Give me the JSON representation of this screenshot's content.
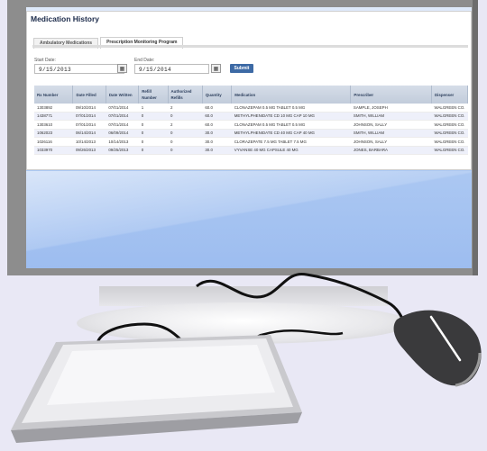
{
  "app_title": "Medication History",
  "tabs": [
    "Ambulatory Medications",
    "Prescription Monitoring Program"
  ],
  "active_tab": 1,
  "form": {
    "start_label": "Start Date:",
    "start_value": "9/15/2013",
    "end_label": "End Date:",
    "end_value": "9/15/2014",
    "submit_label": "Submit"
  },
  "table": {
    "columns": [
      "Rx Number",
      "Date Filled",
      "Date Written",
      "Refill Number",
      "Authorized Refills",
      "Quantity",
      "Medication",
      "Prescriber",
      "Dispenser"
    ],
    "rows": [
      [
        "1303892",
        "09/10/2014",
        "07/01/2014",
        "1",
        "2",
        "60.0",
        "CLONAZEPAM 0.5 MG TABLET 0.5 MG",
        "SAMPLE, JOSEPH",
        "WALGREEN CO."
      ],
      [
        "1438771",
        "07/01/2014",
        "07/01/2014",
        "0",
        "0",
        "60.0",
        "METHYLPHENIDATE CD 10 MG CAP 10 MG",
        "SMITH, WILLIAM",
        "WALGREEN CO."
      ],
      [
        "1303610",
        "07/01/2014",
        "07/01/2014",
        "0",
        "2",
        "60.0",
        "CLONAZEPAM 0.5 MG TABLET 0.5 MG",
        "JOHNSON, SALLY",
        "WALGREEN CO."
      ],
      [
        "1062023",
        "06/14/2014",
        "06/09/2014",
        "0",
        "0",
        "30.0",
        "METHYLPHENIDATE CD 40 MG CAP 40 MG",
        "SMITH, WILLIAM",
        "WALGREEN CO."
      ],
      [
        "1026116",
        "10/14/2013",
        "10/14/2013",
        "0",
        "0",
        "30.0",
        "CLORAZEPATE 7.5 MG TABLET 7.5 MG",
        "JOHNSON, SALLY",
        "WALGREEN CO."
      ],
      [
        "1033970",
        "09/26/2013",
        "09/25/2013",
        "0",
        "0",
        "30.0",
        "VYVANSE 40 MG CAPSULE 40 MG",
        "JONES, BARBARA",
        "WALGREEN CO."
      ]
    ]
  },
  "colors": {
    "header_bg": "#c2ccdb",
    "submit_bg": "#3d6aa5",
    "screen_blue": "#9dbdf0",
    "bezel": "#8d8d8d"
  },
  "icons": {
    "calendar": "calendar-icon",
    "mouse": "mouse-icon",
    "keyboard": "keyboard-icon"
  }
}
